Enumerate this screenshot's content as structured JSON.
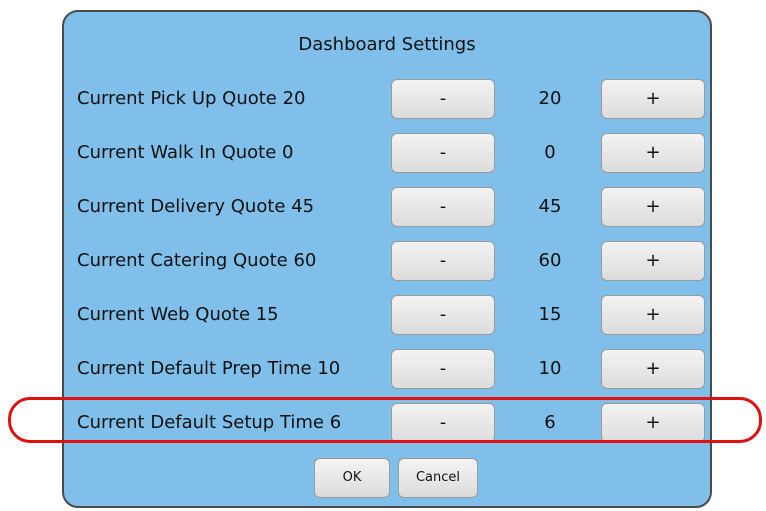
{
  "dialog": {
    "title": "Dashboard Settings"
  },
  "rows": [
    {
      "label": "Current Pick Up Quote 20",
      "value": "20",
      "minus": "-",
      "plus": "+"
    },
    {
      "label": "Current Walk In Quote 0",
      "value": "0",
      "minus": "-",
      "plus": "+"
    },
    {
      "label": "Current Delivery Quote 45",
      "value": "45",
      "minus": "-",
      "plus": "+"
    },
    {
      "label": "Current Catering Quote 60",
      "value": "60",
      "minus": "-",
      "plus": "+"
    },
    {
      "label": "Current Web Quote 15",
      "value": "15",
      "minus": "-",
      "plus": "+"
    },
    {
      "label": "Current Default Prep Time 10",
      "value": "10",
      "minus": "-",
      "plus": "+"
    },
    {
      "label": "Current Default Setup Time 6",
      "value": "6",
      "minus": "-",
      "plus": "+"
    }
  ],
  "footer": {
    "ok_label": "OK",
    "cancel_label": "Cancel"
  },
  "colors": {
    "dialog_background": "#7fbfea",
    "highlight": "#e01010"
  }
}
